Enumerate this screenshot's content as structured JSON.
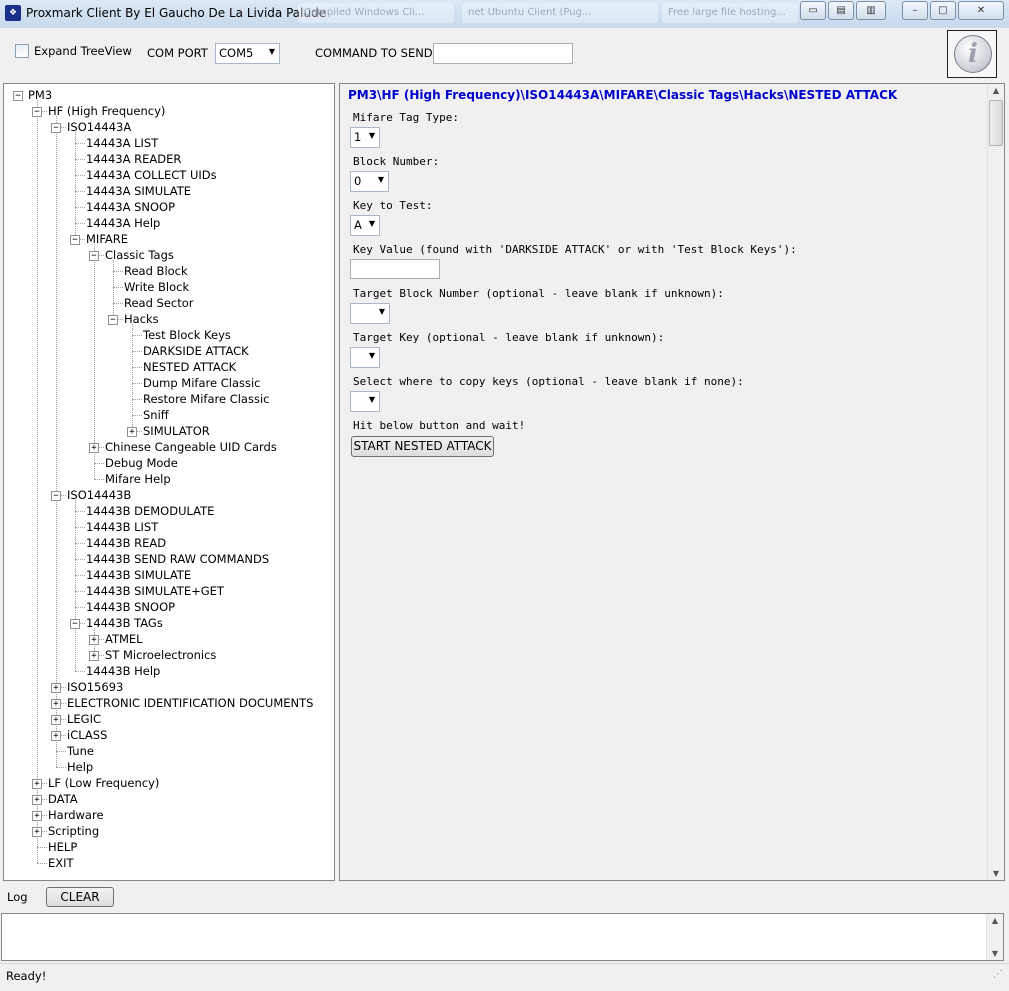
{
  "window": {
    "title": "Proxmark Client By El Gaucho De La Livida Palude",
    "background_tabs": [
      "Compiled Windows Cli...",
      "net Ubuntu Client (Pug...",
      "Free large file hosting..."
    ]
  },
  "toolbar": {
    "expand_treeview_label": "Expand TreeView",
    "expand_treeview_checked": false,
    "com_port_label": "COM PORT",
    "com_port_value": "COM5",
    "command_label": "COMMAND TO SEND",
    "command_value": "",
    "info_icon": "info-icon"
  },
  "tree": {
    "nodes": [
      {
        "label": "PM3",
        "expander": "minus"
      },
      {
        "label": "HF (High Frequency)",
        "expander": "minus"
      },
      {
        "label": "ISO14443A",
        "expander": "minus"
      },
      {
        "label": "14443A LIST",
        "expander": ""
      },
      {
        "label": "14443A READER",
        "expander": ""
      },
      {
        "label": "14443A COLLECT UIDs",
        "expander": ""
      },
      {
        "label": "14443A SIMULATE",
        "expander": ""
      },
      {
        "label": "14443A SNOOP",
        "expander": ""
      },
      {
        "label": "14443A Help",
        "expander": ""
      },
      {
        "label": "MIFARE",
        "expander": "minus"
      },
      {
        "label": "Classic Tags",
        "expander": "minus"
      },
      {
        "label": "Read Block",
        "expander": ""
      },
      {
        "label": "Write Block",
        "expander": ""
      },
      {
        "label": "Read Sector",
        "expander": ""
      },
      {
        "label": "Hacks",
        "expander": "minus"
      },
      {
        "label": "Test Block Keys",
        "expander": ""
      },
      {
        "label": "DARKSIDE ATTACK",
        "expander": ""
      },
      {
        "label": "NESTED ATTACK",
        "expander": ""
      },
      {
        "label": "Dump Mifare Classic",
        "expander": ""
      },
      {
        "label": "Restore Mifare Classic",
        "expander": ""
      },
      {
        "label": "Sniff",
        "expander": ""
      },
      {
        "label": "SIMULATOR",
        "expander": "plus"
      },
      {
        "label": "Chinese Cangeable UID Cards",
        "expander": "plus"
      },
      {
        "label": "Debug Mode",
        "expander": ""
      },
      {
        "label": "Mifare Help",
        "expander": ""
      },
      {
        "label": "ISO14443B",
        "expander": "minus"
      },
      {
        "label": "14443B DEMODULATE",
        "expander": ""
      },
      {
        "label": "14443B LIST",
        "expander": ""
      },
      {
        "label": "14443B READ",
        "expander": ""
      },
      {
        "label": "14443B SEND RAW COMMANDS",
        "expander": ""
      },
      {
        "label": "14443B SIMULATE",
        "expander": ""
      },
      {
        "label": "14443B SIMULATE+GET",
        "expander": ""
      },
      {
        "label": "14443B SNOOP",
        "expander": ""
      },
      {
        "label": "14443B TAGs",
        "expander": "minus"
      },
      {
        "label": "ATMEL",
        "expander": "plus"
      },
      {
        "label": "ST Microelectronics",
        "expander": "plus"
      },
      {
        "label": "14443B Help",
        "expander": ""
      },
      {
        "label": "ISO15693",
        "expander": "plus"
      },
      {
        "label": "ELECTRONIC IDENTIFICATION DOCUMENTS",
        "expander": "plus"
      },
      {
        "label": "LEGIC",
        "expander": "plus"
      },
      {
        "label": "iCLASS",
        "expander": "plus"
      },
      {
        "label": "Tune",
        "expander": ""
      },
      {
        "label": "Help",
        "expander": ""
      },
      {
        "label": "LF (Low Frequency)",
        "expander": "plus"
      },
      {
        "label": "DATA",
        "expander": "plus"
      },
      {
        "label": "Hardware",
        "expander": "plus"
      },
      {
        "label": "Scripting",
        "expander": "plus"
      },
      {
        "label": "HELP",
        "expander": ""
      },
      {
        "label": "EXIT",
        "expander": ""
      }
    ]
  },
  "panel": {
    "breadcrumb": "PM3\\HF (High Frequency)\\ISO14443A\\MIFARE\\Classic Tags\\Hacks\\NESTED ATTACK",
    "tag_type_label": "Mifare Tag Type:",
    "tag_type_value": "1",
    "block_number_label": "Block Number:",
    "block_number_value": "0",
    "key_to_test_label": "Key to Test:",
    "key_to_test_value": "A",
    "key_value_label": "Key Value (found with 'DARKSIDE ATTACK' or with 'Test Block Keys'):",
    "key_value": "",
    "target_block_label": "Target Block Number (optional - leave blank if unknown):",
    "target_block_value": "",
    "target_key_label": "Target Key (optional - leave blank if unknown):",
    "target_key_value": "",
    "copy_keys_label": "Select where to copy keys (optional - leave blank if none):",
    "copy_keys_value": "",
    "hint": "Hit below button and wait!",
    "start_button": "START NESTED ATTACK"
  },
  "log": {
    "label": "Log",
    "clear_button": "CLEAR",
    "content": ""
  },
  "status": {
    "text": "Ready!"
  }
}
